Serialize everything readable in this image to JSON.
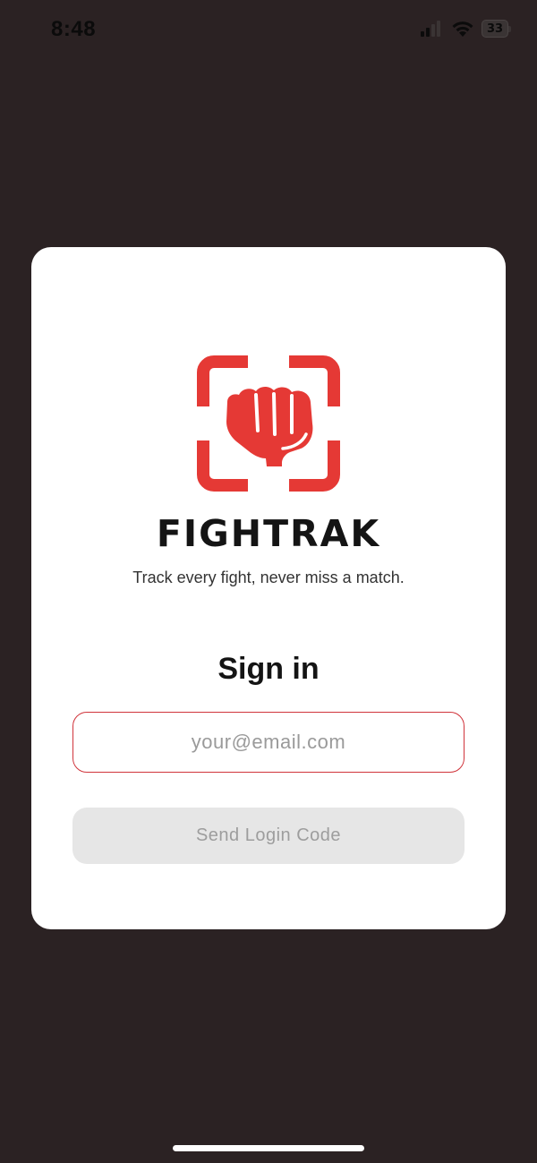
{
  "status_bar": {
    "time": "8:48",
    "battery_level": "33",
    "icons": [
      "cellular-signal-icon",
      "wifi-icon",
      "battery-icon"
    ]
  },
  "logo": {
    "icon": "fist-icon",
    "wordmark": "FIGHTRAK",
    "tagline": "Track every fight, never miss a match.",
    "brand_color": "#e53935"
  },
  "form": {
    "title": "Sign in",
    "email_placeholder": "your@email.com",
    "email_value": "",
    "submit_label": "Send Login Code"
  },
  "colors": {
    "background": "#2b2223",
    "card": "#ffffff",
    "input_border": "#d0343b",
    "button_disabled": "#e6e6e6"
  }
}
